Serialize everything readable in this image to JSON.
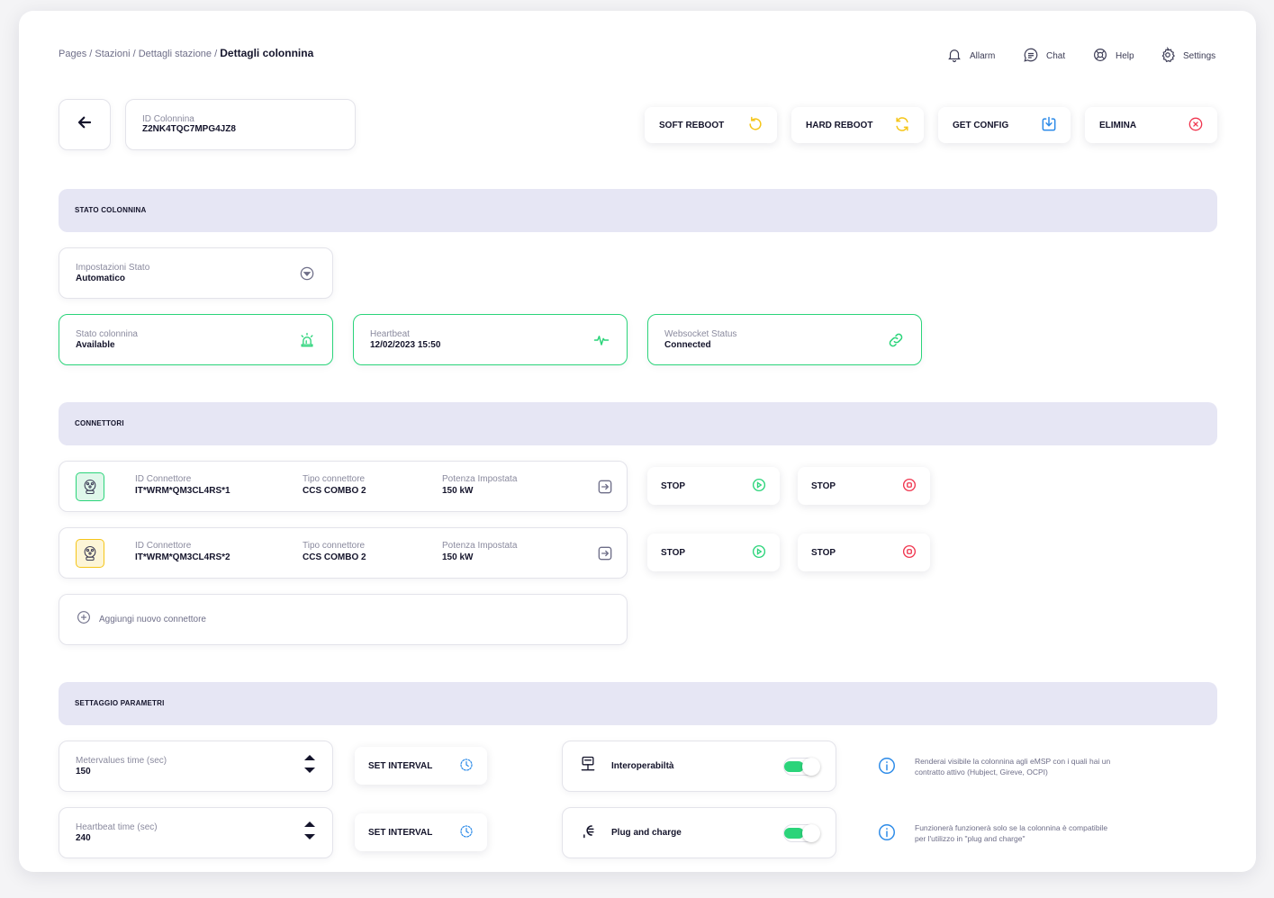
{
  "breadcrumb": {
    "root": "Pages",
    "sep1": "/",
    "level1": "Stazioni",
    "sep2": "/",
    "level2": "Dettagli stazione",
    "sep3": "/",
    "current": "Dettagli colonnina"
  },
  "topnav": {
    "alarm": "Allarm",
    "chat": "Chat",
    "help": "Help",
    "settings": "Settings"
  },
  "id_card": {
    "label": "ID Colonnina",
    "value": "Z2NK4TQC7MPG4JZ8"
  },
  "actions": {
    "soft_reboot": "SOFT REBOOT",
    "hard_reboot": "HARD REBOOT",
    "get_config": "GET CONFIG",
    "delete": "ELIMINA"
  },
  "sections": {
    "stato": "STATO COLONNINA",
    "connettori": "CONNETTORI",
    "parametri": "SETTAGGIO PARAMETRI"
  },
  "impostazioni": {
    "label": "Impostazioni Stato",
    "value": "Automatico"
  },
  "status_cards": [
    {
      "label": "Stato colonnina",
      "value": "Available"
    },
    {
      "label": "Heartbeat",
      "value": "12/02/2023 15:50"
    },
    {
      "label": "Websocket Status",
      "value": "Connected"
    }
  ],
  "connectors": [
    {
      "id_label": "ID Connettore",
      "id": "IT*WRM*QM3CL4RS*1",
      "type_label": "Tipo connettore",
      "type": "CCS COMBO 2",
      "power_label": "Potenza Impostata",
      "power": "150 kW",
      "start_label": "STOP",
      "stop_label": "STOP"
    },
    {
      "id_label": "ID Connettore",
      "id": "IT*WRM*QM3CL4RS*2",
      "type_label": "Tipo connettore",
      "type": "CCS COMBO 2",
      "power_label": "Potenza Impostata",
      "power": "150 kW",
      "start_label": "STOP",
      "stop_label": "STOP"
    }
  ],
  "add_connector": "Aggiungi nuovo connettore",
  "params": [
    {
      "label": "Metervalues time (sec)",
      "value": "150",
      "button": "SET INTERVAL"
    },
    {
      "label": "Heartbeat time (sec)",
      "value": "240",
      "button": "SET INTERVAL"
    }
  ],
  "toggles": [
    {
      "label": "Interoperabiltà",
      "enabled": true,
      "info": "Renderai visibile la colonnina agli eMSP con i quali hai un contratto attivo (Hubject, Gireve, OCPI)"
    },
    {
      "label": "Plug and charge",
      "enabled": true,
      "info": "Funzionerà funzionerà solo se la colonnina è compatibile per l'utilizzo in \"plug and charge\""
    }
  ],
  "colors": {
    "accent_green": "#2bd47a",
    "warning_yellow": "#f5c518",
    "danger_red": "#f0364f",
    "info_blue": "#2b8ae8",
    "section_bg": "#e6e6f4",
    "navy": "#14142b"
  }
}
